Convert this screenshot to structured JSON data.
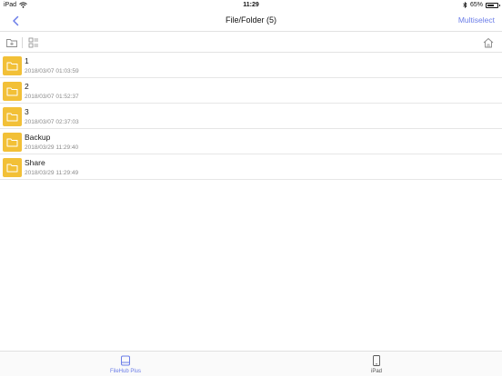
{
  "status_bar": {
    "device": "iPad",
    "time": "11:29",
    "battery_percent": "65%",
    "battery_level": 0.65
  },
  "nav": {
    "title": "File/Folder (5)",
    "multiselect_label": "Multiselect"
  },
  "files": [
    {
      "name": "1",
      "date": "2018/03/07 01:03:59"
    },
    {
      "name": "2",
      "date": "2018/03/07 01:52:37"
    },
    {
      "name": "3",
      "date": "2018/03/07 02:37:03"
    },
    {
      "name": "Backup",
      "date": "2018/03/29 11:29:40"
    },
    {
      "name": "Share",
      "date": "2018/03/29 11:29:49"
    }
  ],
  "tabs": [
    {
      "label": "FileHub Plus",
      "icon": "drive-icon",
      "active": true
    },
    {
      "label": "iPad",
      "icon": "tablet-icon",
      "active": false
    }
  ],
  "colors": {
    "accent": "#6b7de8",
    "folder": "#f2c037",
    "inactive_tab": "#555555"
  }
}
